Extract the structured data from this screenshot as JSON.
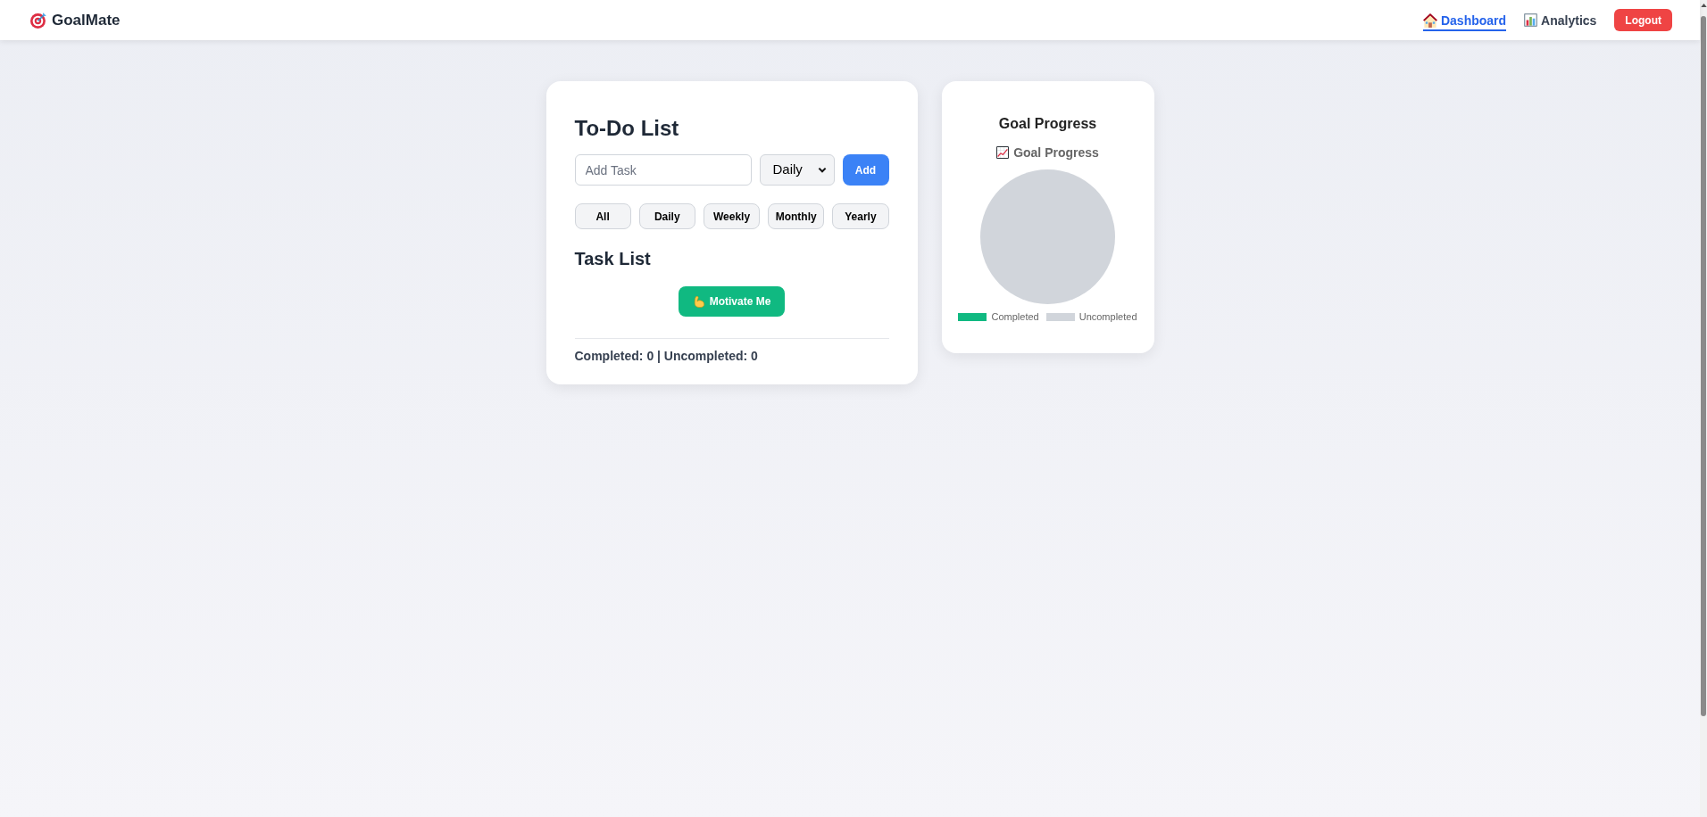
{
  "header": {
    "logo": {
      "text": "GoalMate"
    },
    "nav": [
      {
        "label": "Dashboard",
        "selected": true
      },
      {
        "label": "Analytics",
        "selected": false
      }
    ],
    "logout_button": "Logout"
  },
  "todo_card": {
    "title": "To-Do List",
    "task_input": {
      "placeholder": "Add Task"
    },
    "frequency_select": {
      "value": "Daily"
    },
    "add_button": "Add",
    "filters": [
      "All",
      "Daily",
      "Weekly",
      "Monthly",
      "Yearly"
    ],
    "task_list_title": "Task List",
    "motivate_button": "Motivate Me",
    "summary": "Completed: 0 | Uncompleted: 0"
  },
  "goal_progress_card": {
    "title": "Goal Progress",
    "chart_title": "Goal Progress",
    "legend": [
      {
        "label": "Completed",
        "color": "#10b981"
      },
      {
        "label": "Uncompleted",
        "color": "#d1d5db"
      }
    ]
  }
}
